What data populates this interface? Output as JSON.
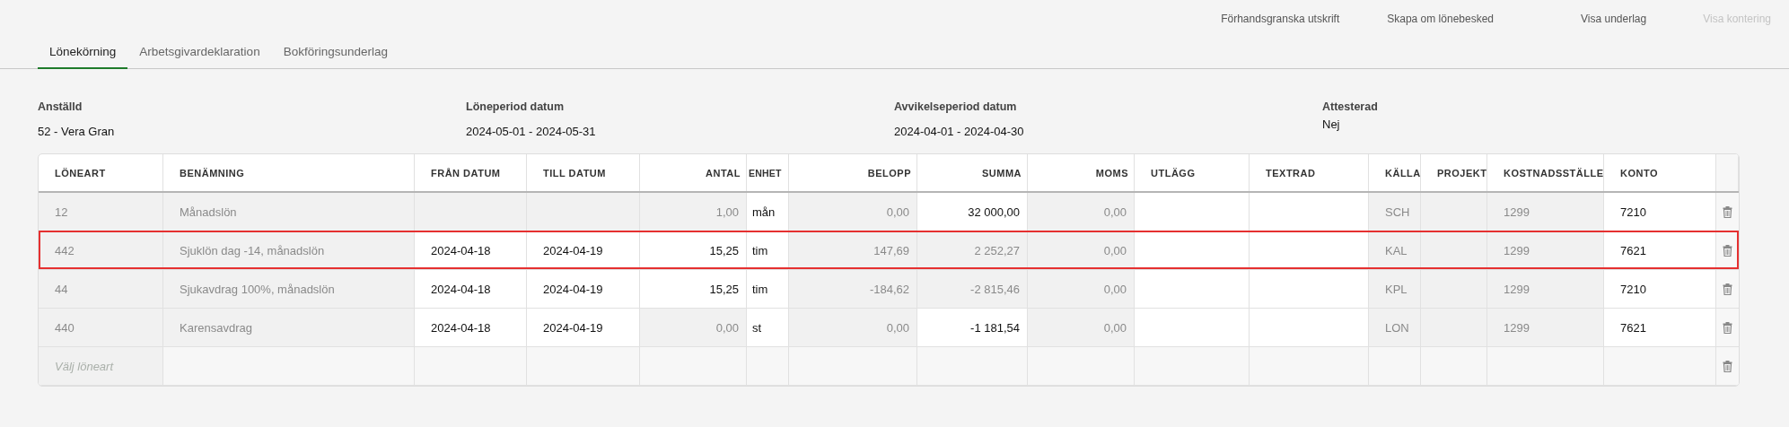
{
  "actions": [
    {
      "label": "Förhandsgranska utskrift",
      "disabled": false
    },
    {
      "label": "Skapa om lönebesked",
      "disabled": false
    },
    {
      "label": "Visa underlag",
      "disabled": false
    },
    {
      "label": "Visa kontering",
      "disabled": true
    }
  ],
  "tabs": [
    {
      "label": "Lönekörning",
      "selected": true
    },
    {
      "label": "Arbetsgivardeklaration",
      "selected": false
    },
    {
      "label": "Bokföringsunderlag",
      "selected": false
    }
  ],
  "summary": [
    {
      "label": "Anställd",
      "value": "52 - Vera Gran"
    },
    {
      "label": "Löneperiod datum",
      "value": "2024-05-01 - 2024-05-31"
    },
    {
      "label": "Avvikelseperiod datum",
      "value": "2024-04-01 - 2024-04-30"
    },
    {
      "label": "Attesterad",
      "value": "Nej"
    }
  ],
  "table": {
    "columns": [
      "LÖNEART",
      "BENÄMNING",
      "FRÅN DATUM",
      "TILL DATUM",
      "ANTAL",
      "ENHET",
      "BELOPP",
      "SUMMA",
      "MOMS",
      "UTLÄGG",
      "TEXTRAD",
      "KÄLLA",
      "PROJEKT",
      "KOSTNADSSTÄLLE",
      "KONTO"
    ],
    "rows": [
      {
        "selected": false,
        "cells": [
          {
            "text": "12",
            "editable": false
          },
          {
            "text": "Månadslön",
            "editable": false
          },
          {
            "editable": false
          },
          {
            "editable": false
          },
          {
            "text": "1,00",
            "editable": false
          },
          {
            "text": "mån",
            "editable": true
          },
          {
            "text": "0,00",
            "editable": false
          },
          {
            "text": "32 000,00",
            "editable": true
          },
          {
            "text": "0,00",
            "editable": false
          },
          {
            "editable": true
          },
          {
            "editable": true
          },
          {
            "text": "SCH",
            "editable": false
          },
          {
            "editable": false
          },
          {
            "text": "1299",
            "editable": false
          },
          {
            "text": "7210",
            "editable": true
          }
        ]
      },
      {
        "selected": true,
        "cells": [
          {
            "text": "442",
            "editable": false
          },
          {
            "text": "Sjuklön dag -14, månadslön",
            "editable": false
          },
          {
            "text": "2024-04-18",
            "editable": true
          },
          {
            "text": "2024-04-19",
            "editable": true
          },
          {
            "text": "15,25",
            "editable": true
          },
          {
            "text": "tim",
            "editable": true
          },
          {
            "text": "147,69",
            "editable": false
          },
          {
            "text": "2 252,27",
            "editable": false
          },
          {
            "text": "0,00",
            "editable": false
          },
          {
            "editable": true
          },
          {
            "editable": true
          },
          {
            "text": "KAL",
            "editable": false
          },
          {
            "editable": false
          },
          {
            "text": "1299",
            "editable": false
          },
          {
            "text": "7621",
            "editable": true
          }
        ]
      },
      {
        "selected": false,
        "cells": [
          {
            "text": "44",
            "editable": false
          },
          {
            "text": "Sjukavdrag 100%, månadslön",
            "editable": false
          },
          {
            "text": "2024-04-18",
            "editable": true
          },
          {
            "text": "2024-04-19",
            "editable": true
          },
          {
            "text": "15,25",
            "editable": true
          },
          {
            "text": "tim",
            "editable": true
          },
          {
            "text": "-184,62",
            "editable": false
          },
          {
            "text": "-2 815,46",
            "editable": false
          },
          {
            "text": "0,00",
            "editable": false
          },
          {
            "editable": true
          },
          {
            "editable": true
          },
          {
            "text": "KPL",
            "editable": false
          },
          {
            "editable": false
          },
          {
            "text": "1299",
            "editable": false
          },
          {
            "text": "7210",
            "editable": true
          }
        ]
      },
      {
        "selected": false,
        "cells": [
          {
            "text": "440",
            "editable": false
          },
          {
            "text": "Karensavdrag",
            "editable": false
          },
          {
            "text": "2024-04-18",
            "editable": true
          },
          {
            "text": "2024-04-19",
            "editable": true
          },
          {
            "text": "0,00",
            "editable": false
          },
          {
            "text": "st",
            "editable": true
          },
          {
            "text": "0,00",
            "editable": false
          },
          {
            "text": "-1 181,54",
            "editable": true
          },
          {
            "text": "0,00",
            "editable": false
          },
          {
            "editable": true
          },
          {
            "editable": true
          },
          {
            "text": "LON",
            "editable": false
          },
          {
            "editable": false
          },
          {
            "text": "1299",
            "editable": false
          },
          {
            "text": "7621",
            "editable": true
          }
        ]
      }
    ],
    "new_row": {
      "placeholder": "Välj löneart"
    }
  }
}
